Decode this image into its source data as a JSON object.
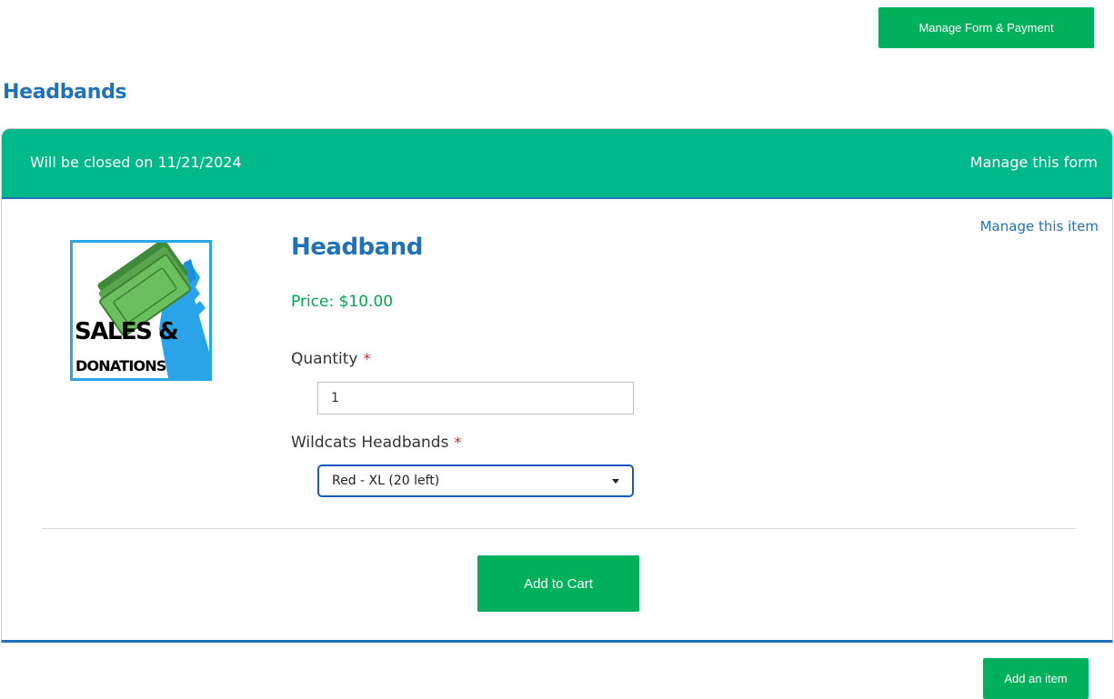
{
  "toolbar": {
    "manage_form_payment_label": "Manage Form & Payment"
  },
  "section": {
    "title": "Headbands"
  },
  "form": {
    "closed_text": "Will be closed on 11/21/2024",
    "manage_form_label": "Manage this form"
  },
  "item": {
    "manage_item_label": "Manage this item",
    "image": {
      "line1": "SALES &",
      "line2": "DONATIONS"
    },
    "name": "Headband",
    "price": "Price: $10.00",
    "quantity": {
      "label": "Quantity",
      "required_mark": "*",
      "value": "1"
    },
    "option": {
      "label": "Wildcats Headbands",
      "required_mark": "*",
      "selected": "Red - XL (20 left)"
    },
    "add_to_cart_label": "Add to Cart"
  },
  "footer": {
    "add_item_label": "Add an item"
  },
  "colors": {
    "primary_green": "#00b05a",
    "header_teal": "#00b98a",
    "brand_blue": "#1f72b8",
    "required_red": "#e02020"
  },
  "icons": {
    "dropdown": "chevron-down-icon"
  }
}
